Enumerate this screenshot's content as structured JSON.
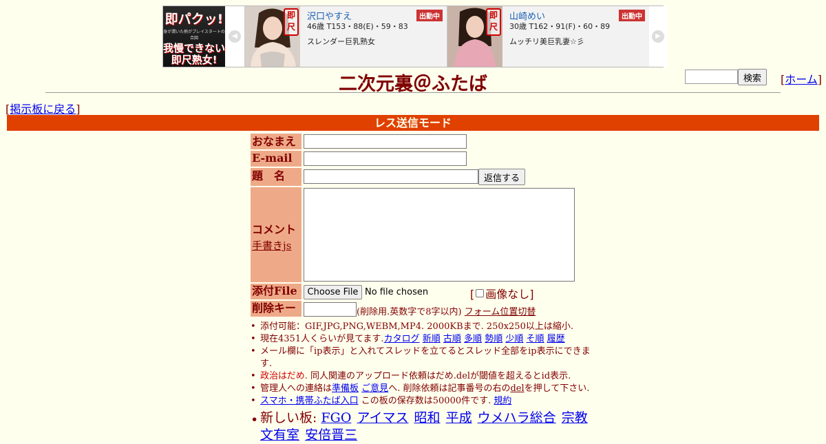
{
  "ad": {
    "logo_line1": "即パクッ!",
    "logo_line2": "身が潤いた熱がプレイスタートの合図",
    "logo_line3": "我慢できない",
    "logo_line4": "即尺熟女!",
    "stamp": "即尺",
    "cards": [
      {
        "name": "沢口やすえ",
        "status": "出勤中",
        "spec": "46歳 T153・88(E)・59・83",
        "desc": "スレンダー巨乳熟女"
      },
      {
        "name": "山崎めい",
        "status": "出勤中",
        "spec": "30歳 T162・91(F)・60・89",
        "desc": "ムッチリ美巨乳妻☆彡"
      }
    ]
  },
  "header": {
    "title": "二次元裏＠ふたば",
    "search_button": "検索",
    "home_link": "ホーム",
    "back_link": "掲示板に戻る",
    "bracket_open": "[",
    "bracket_close": "]"
  },
  "mode_title": "レス送信モード",
  "form": {
    "name_label": "おなまえ",
    "email_label": "E-mail",
    "subject_label": "題　名",
    "reply_button": "返信する",
    "comment_label": "コメント",
    "handwrite_link": "手書きjs",
    "file_label": "添付File",
    "choose_file_button": "Choose File",
    "no_file_text": "No file chosen",
    "no_image_label": "画像なし",
    "delkey_label": "削除キー",
    "delkey_note": "(削除用.英数字で8字以内)",
    "form_position_link": "フォーム位置切替"
  },
  "notes": {
    "n1": "添付可能：GIF,JPG,PNG,WEBM,MP4. 2000KBまで. 250x250以上は縮小.",
    "n2_prefix": "現在4351人くらいが見てます.",
    "n2_links": [
      "カタログ",
      "新順",
      "古順",
      "多順",
      "勢順",
      "少順",
      "そ順",
      "履歴"
    ],
    "n3": "メール欄に「ip表示」と入れてスレッドを立てるとスレッド全部をip表示にできます.",
    "n4_red": "政治はだめ.",
    "n4_rest": "同人関連のアップロード依頼はだめ.delが閾値を超えるとid表示.",
    "n5_a": "管理人への連絡は",
    "n5_link1": "準備板",
    "n5_link2": "ご意見",
    "n5_b": "へ. 削除依頼は記事番号の右の",
    "n5_del": "del",
    "n5_c": "を押して下さい.",
    "n6_link": "スマホ・携帯ふたば入口",
    "n6_text": "この板の保存数は50000件です.",
    "n6_rules": "規約",
    "new_boards_label": "新しい板:",
    "new_boards": [
      "FGO",
      "アイマス",
      "昭和",
      "平成",
      "ウメハラ総合",
      "宗教",
      "文有室",
      "安倍晋三"
    ]
  },
  "colors": {
    "background": "#ffffee",
    "text": "#800000",
    "mode_bar": "#e04000",
    "label_bg": "#eeaa88",
    "link": "#0000ee"
  }
}
